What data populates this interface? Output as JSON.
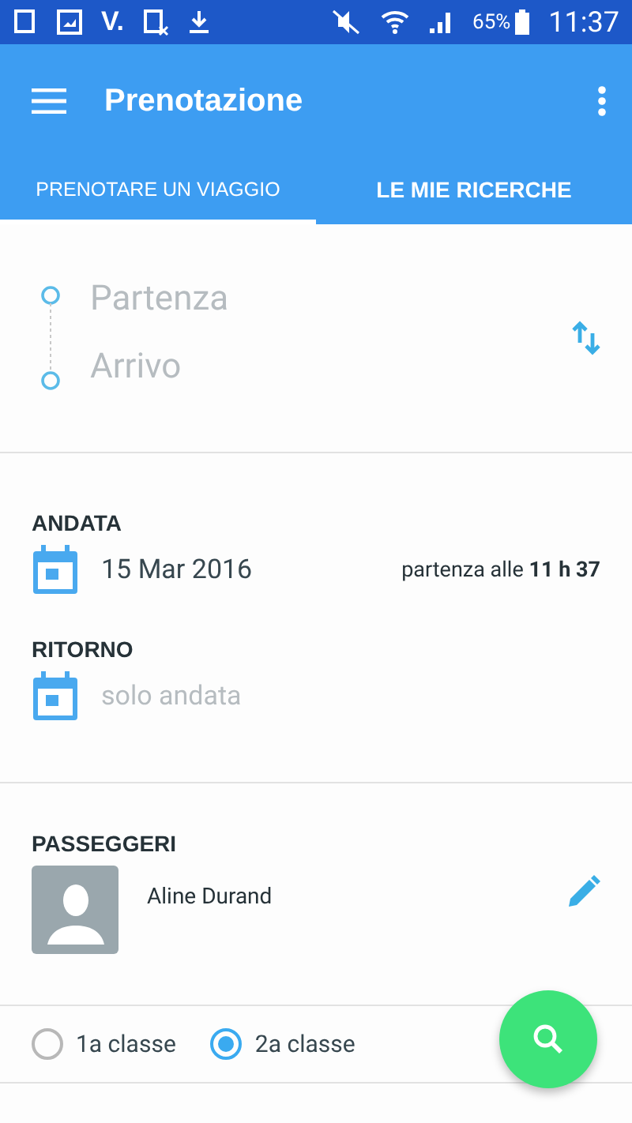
{
  "status_bar": {
    "app_badge": "V.",
    "battery": "65%",
    "time": "11:37"
  },
  "app_bar": {
    "title": "Prenotazione"
  },
  "tabs": [
    {
      "label": "PRENOTARE UN VIAGGIO",
      "selected": true
    },
    {
      "label": "LE MIE RICERCHE",
      "selected": false
    }
  ],
  "route": {
    "from_placeholder": "Partenza",
    "to_placeholder": "Arrivo"
  },
  "outbound": {
    "label": "ANDATA",
    "date": "15 Mar 2016",
    "departure": "partenza alle **11 h 37**"
  },
  "return": {
    "label": "RITORNO",
    "date_placeholder": "solo andata"
  },
  "passengers": {
    "label": "PASSEGGERI",
    "items": [
      {
        "name": "Aline Durand"
      }
    ]
  },
  "travel_class": [
    {
      "label": "1a classe",
      "selected": false
    },
    {
      "label": "2a classe",
      "selected": true
    }
  ]
}
